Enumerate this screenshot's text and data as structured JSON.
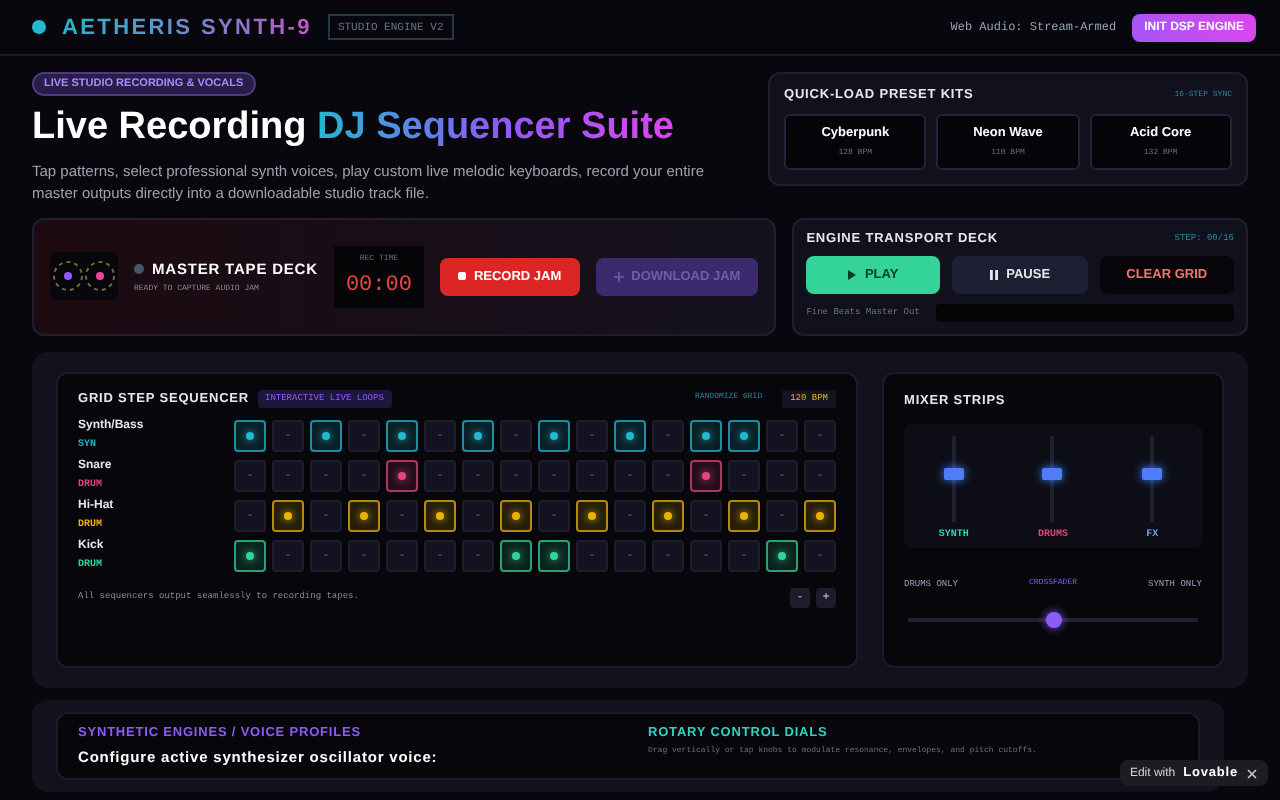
{
  "header": {
    "brand": "AETHERIS SYNTH-9",
    "version_badge": "STUDIO ENGINE V2",
    "status": "Web Audio: Stream-Armed",
    "init_button": "INIT DSP ENGINE"
  },
  "hero": {
    "badge": "LIVE STUDIO RECORDING & VOCALS",
    "title_plain": "Live Recording ",
    "title_gradient": "DJ Sequencer Suite",
    "description": "Tap patterns, select professional synth voices, play custom live melodic keyboards, record your entire master outputs directly into a downloadable studio track file."
  },
  "preset_kits": {
    "title": "QUICK-LOAD PRESET KITS",
    "tag": "16-STEP SYNC",
    "kits": [
      {
        "name": "Cyberpunk",
        "bpm": "128 BPM"
      },
      {
        "name": "Neon Wave",
        "bpm": "110 BPM"
      },
      {
        "name": "Acid Core",
        "bpm": "132 BPM"
      }
    ]
  },
  "tape_deck": {
    "title": "MASTER TAPE DECK",
    "subtitle": "READY TO CAPTURE AUDIO JAM",
    "recording": false,
    "time_label": "REC TIME",
    "time": "00:00",
    "record_button": "RECORD JAM",
    "download_button": {
      "label": "DOWNLOAD JAM",
      "disabled": true
    }
  },
  "transport": {
    "title": "ENGINE TRANSPORT DECK",
    "step": "STEP: 00/16",
    "buttons": [
      {
        "kind": "play",
        "label": "PLAY"
      },
      {
        "kind": "pause",
        "label": "PAUSE"
      },
      {
        "kind": "clear",
        "label": "CLEAR GRID"
      }
    ],
    "master_label": "Fine Beats Master Out"
  },
  "sequencer": {
    "title": "GRID STEP SEQUENCER",
    "badge": "INTERACTIVE LIVE LOOPS",
    "randomize": "RANDOMIZE GRID",
    "bpm": "120 BPM",
    "tracks": [
      {
        "name": "Synth/Bass",
        "type": "SYN",
        "color": "#22b8cf",
        "steps": [
          true,
          false,
          true,
          false,
          true,
          false,
          true,
          false,
          true,
          false,
          true,
          false,
          true,
          true,
          false,
          false
        ]
      },
      {
        "name": "Snare",
        "type": "DRUM",
        "color": "#e0457b",
        "steps": [
          false,
          false,
          false,
          false,
          true,
          false,
          false,
          false,
          false,
          false,
          false,
          false,
          true,
          false,
          false,
          false
        ]
      },
      {
        "name": "Hi-Hat",
        "type": "DRUM",
        "color": "#eab308",
        "steps": [
          false,
          true,
          false,
          true,
          false,
          true,
          false,
          true,
          false,
          true,
          false,
          true,
          false,
          true,
          false,
          true
        ]
      },
      {
        "name": "Kick",
        "type": "DRUM",
        "color": "#34d399",
        "steps": [
          true,
          false,
          false,
          false,
          false,
          false,
          false,
          true,
          true,
          false,
          false,
          false,
          false,
          false,
          true,
          false
        ]
      }
    ],
    "footer": "All sequencers output seamlessly to recording tapes.",
    "nav_buttons": [
      "-",
      "+"
    ]
  },
  "mixer": {
    "title": "MIXER STRIPS",
    "strips": [
      {
        "label": "SYNTH",
        "color": "#2dd4bf",
        "level": 0.55
      },
      {
        "label": "DRUMS",
        "color": "#e0457b",
        "level": 0.55
      },
      {
        "label": "FX",
        "color": "#60a5fa",
        "level": 0.55
      }
    ],
    "crossfader": {
      "left": "DRUMS ONLY",
      "center": "CROSSFADER",
      "right": "SYNTH ONLY",
      "level": 0.5
    }
  },
  "engines": {
    "title": "SYNTHETIC ENGINES / VOICE PROFILES",
    "prompt": "Configure active synthesizer oscillator voice:"
  },
  "dials": {
    "title": "ROTARY CONTROL DIALS",
    "hint": "Drag vertically or tap knobs to modulate resonance, envelopes, and pitch cutoffs."
  },
  "badge": {
    "label": "Edit with",
    "brand": "Lovable"
  }
}
